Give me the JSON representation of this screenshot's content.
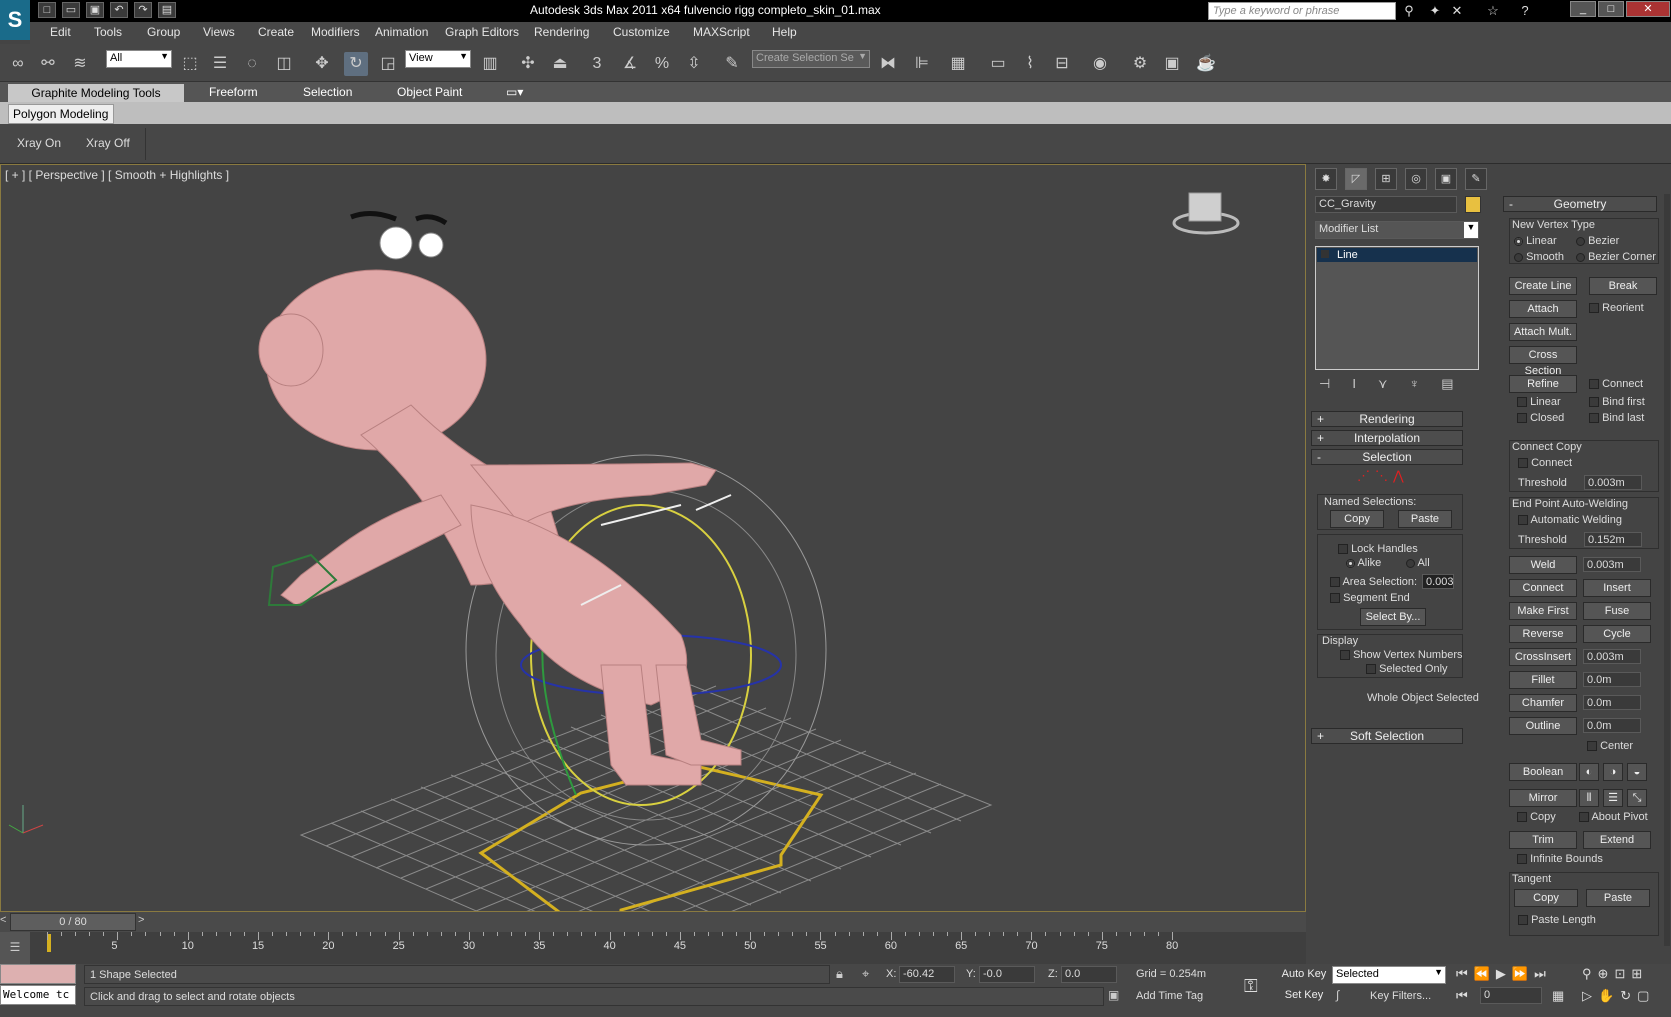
{
  "window": {
    "title": "Autodesk 3ds Max  2011 x64      fulvencio rigg completo_skin_01.max",
    "search_placeholder": "Type a keyword or phrase"
  },
  "menu": [
    "Edit",
    "Tools",
    "Group",
    "Views",
    "Create",
    "Modifiers",
    "Animation",
    "Graph Editors",
    "Rendering",
    "Customize",
    "MAXScript",
    "Help"
  ],
  "toolbar": {
    "selection_filter": "All",
    "reference_coord": "View",
    "named_selection": "Create Selection Se",
    "snap_label": "3"
  },
  "ribbon": {
    "tabs": [
      "Graphite Modeling Tools",
      "Freeform",
      "Selection",
      "Object Paint"
    ],
    "subtab": "Polygon Modeling",
    "xray_on": "Xray On",
    "xray_off": "Xray Off"
  },
  "viewport": {
    "label": "[ + ] [ Perspective ] [ Smooth + Highlights ]",
    "time_position": "0 / 80"
  },
  "command_panel": {
    "object_name": "CC_Gravity",
    "object_color": "#e8c040",
    "modifier_list": "Modifier List",
    "stack_item": "Line",
    "rollouts": {
      "rendering": "Rendering",
      "interpolation": "Interpolation",
      "selection": "Selection",
      "soft_selection": "Soft Selection"
    },
    "named_selections": "Named Selections:",
    "copy": "Copy",
    "paste": "Paste",
    "lock_handles": "Lock Handles",
    "alike": "Alike",
    "all": "All",
    "area_selection": "Area Selection:",
    "area_value": "0.003",
    "segment_end": "Segment End",
    "select_by": "Select By...",
    "display": "Display",
    "show_vertex_numbers": "Show Vertex Numbers",
    "selected_only": "Selected Only",
    "whole_object": "Whole Object Selected"
  },
  "geometry": {
    "header": "Geometry",
    "new_vertex_type": "New Vertex Type",
    "linear": "Linear",
    "bezier": "Bezier",
    "smooth": "Smooth",
    "bezier_corner": "Bezier Corner",
    "create_line": "Create Line",
    "break": "Break",
    "attach": "Attach",
    "reorient": "Reorient",
    "attach_mult": "Attach Mult.",
    "cross_section": "Cross Section",
    "refine": "Refine",
    "connect": "Connect",
    "linear2": "Linear",
    "bind_first": "Bind first",
    "closed": "Closed",
    "bind_last": "Bind last",
    "connect_copy": "Connect Copy",
    "connect2": "Connect",
    "threshold": "Threshold",
    "threshold_value1": "0.003m",
    "end_point_auto": "End Point Auto-Welding",
    "automatic_welding": "Automatic Welding",
    "threshold2": "Threshold",
    "threshold_value2": "0.152m",
    "weld": "Weld",
    "weld_value": "0.003m",
    "connect3": "Connect",
    "insert": "Insert",
    "make_first": "Make First",
    "fuse": "Fuse",
    "reverse": "Reverse",
    "cycle": "Cycle",
    "crossinsert": "CrossInsert",
    "crossinsert_value": "0.003m",
    "fillet": "Fillet",
    "fillet_value": "0.0m",
    "chamfer": "Chamfer",
    "chamfer_value": "0.0m",
    "outline": "Outline",
    "outline_value": "0.0m",
    "center": "Center",
    "boolean": "Boolean",
    "mirror": "Mirror",
    "copy": "Copy",
    "about_pivot": "About Pivot",
    "trim": "Trim",
    "extend": "Extend",
    "infinite_bounds": "Infinite Bounds",
    "tangent": "Tangent",
    "tcopy": "Copy",
    "tpaste": "Paste",
    "paste_length": "Paste Length"
  },
  "timeline": {
    "ticks": [
      "5",
      "10",
      "15",
      "20",
      "25",
      "30",
      "35",
      "40",
      "45",
      "50",
      "55",
      "60",
      "65",
      "70",
      "75",
      "80"
    ]
  },
  "status": {
    "maxscript": "Welcome tc",
    "selection": "1 Shape Selected",
    "prompt": "Click and drag to select and rotate objects",
    "x_label": "X:",
    "x": "-60.42",
    "y_label": "Y:",
    "y": "-0.0",
    "z_label": "Z:",
    "z": "0.0",
    "grid": "Grid = 0.254m",
    "add_time_tag": "Add Time Tag",
    "auto_key": "Auto Key",
    "set_key": "Set Key",
    "key_mode": "Selected",
    "key_filters": "Key Filters...",
    "frame": "0"
  }
}
